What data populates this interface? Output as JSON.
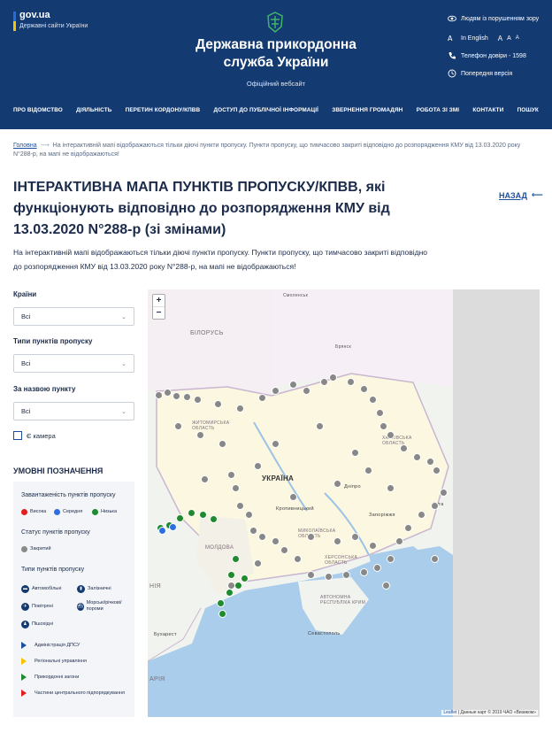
{
  "header": {
    "gov_title": "gov.ua",
    "gov_subtitle": "Державні сайти України",
    "site_title_line1": "Державна прикордонна",
    "site_title_line2": "служба України",
    "official": "Офіційний вебсайт"
  },
  "utility": {
    "accessibility": "Людям із порушенням зору",
    "language": "In English",
    "font_sizes": [
      "A",
      "A",
      "A"
    ],
    "hotline": "Телефон довіри - 1598",
    "previous": "Попередня версія"
  },
  "nav": [
    "ПРО ВІДОМСТВО",
    "ДІЯЛЬНІСТЬ",
    "ПЕРЕТИН КОРДОНУ/КПВВ",
    "ДОСТУП ДО ПУБЛІЧНОЇ ІНФОРМАЦІЇ",
    "ЗВЕРНЕННЯ ГРОМАДЯН",
    "РОБОТА ЗІ ЗМІ",
    "КОНТАКТИ",
    "ПОШУК"
  ],
  "breadcrumb": {
    "home": "Головна",
    "current": "На інтерактивній мапі відображаються тільки діючі пункти пропуску. Пункти пропуску, що тимчасово закриті відповідно до розпорядження КМУ від 13.03.2020 року N°288-р, на мапі не відображаються!"
  },
  "page": {
    "title": "ІНТЕРАКТИВНА МАПА ПУНКТІВ ПРОПУСКУ/КПВВ, які функціонують відповідно до розпорядження КМУ від 13.03.2020 N°288-р (зі змінами)",
    "back": "НАЗАД",
    "lead": "На інтерактивній мапі відображаються тільки діючі пункти пропуску. Пункти пропуску, що тимчасово закриті відповідно до розпорядження КМУ від 13.03.2020 року N°288-р, на мапі не відображаються!"
  },
  "filters": {
    "countries_label": "Країни",
    "countries_value": "Всі",
    "types_label": "Типи пунктів пропуску",
    "types_value": "Всі",
    "name_label": "За назвою пункту",
    "name_value": "Всі",
    "camera_label": "Є камера"
  },
  "legend": {
    "title": "УМОВНІ ПОЗНАЧЕННЯ",
    "load_title": "Завантаженість пунктів пропуску",
    "load": [
      {
        "label": "Висока",
        "color": "#e21e1e"
      },
      {
        "label": "Середня",
        "color": "#2d6fe0"
      },
      {
        "label": "Низька",
        "color": "#1f8a2e"
      }
    ],
    "status_title": "Статус пунктів пропуску",
    "status_closed": "Закритий",
    "types_title": "Типи пунктів пропуску",
    "types": [
      "Автомобільні",
      "Залізничні",
      "Повітряні",
      "Морські/річкові/ пороми",
      "Пішохідні"
    ],
    "admin": [
      {
        "label": "Адміністрація ДПСУ",
        "color": "#1d4f9e"
      },
      {
        "label": "Регіональні управління",
        "color": "#f6c400"
      },
      {
        "label": "Прикордонні загони",
        "color": "#1f8a2e"
      },
      {
        "label": "Частини центрального підпорядкування",
        "color": "#e21e1e"
      }
    ]
  },
  "map": {
    "zoom_in": "+",
    "zoom_out": "−",
    "labels": {
      "belarus": "БІЛОРУСЬ",
      "ukraine": "УКРАЇНА",
      "moldova": "МОЛДОВА",
      "smolensk": "Смоленськ",
      "bryansk": "Брянск",
      "kharkiv_obl": "ХАРКІВСЬКА ОБЛАСТЬ",
      "kropyvnytskyi": "Кропивницький",
      "mykolaiv_obl": "МИКОЛАЇВСЬКА ОБЛАСТЬ",
      "kherson_obl": "ХЕРСОНСЬКА ОБЛАСТЬ",
      "crimea": "АВТОНОМНА РЕСПУБЛІКА КРИМ",
      "sevastopol": "Севастополь",
      "bucharest": "Бухарест",
      "nia": "НІЯ",
      "aria": "АРІЯ",
      "zhytomyr": "ЖИТОМИРСЬКА ОБЛАСТЬ",
      "zaporizhzhia": "Запоріжжя",
      "dnipro": "Дніпро",
      "luhansk": "Луга"
    },
    "attribution_link": "Leaflet",
    "attribution": "| Данные карт © 2019 ЧАО «Визиком»"
  }
}
